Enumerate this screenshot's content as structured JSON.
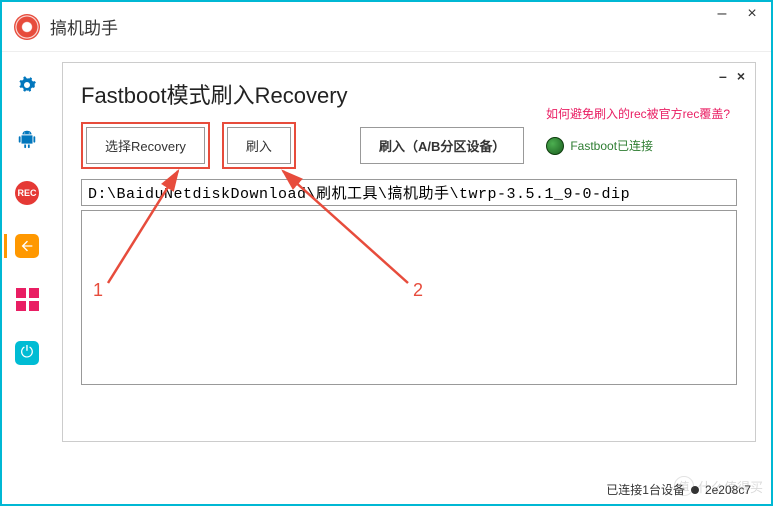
{
  "app": {
    "title": "搞机助手"
  },
  "sidebar": {
    "rec_label": "REC"
  },
  "dialog": {
    "title": "Fastboot模式刷入Recovery",
    "help_link": "如何避免刷入的rec被官方rec覆盖?",
    "select_recovery_label": "选择Recovery",
    "flash_label": "刷入",
    "flash_ab_label": "刷入（A/B分区设备）",
    "status_text": "Fastboot已连接",
    "file_path": "D:\\BaiduNetdiskDownload\\刷机工具\\搞机助手\\twrp-3.5.1_9-0-dip"
  },
  "annotations": {
    "label1": "1",
    "label2": "2"
  },
  "footer": {
    "status": "已连接1台设备",
    "device_id": "2e208c7"
  },
  "watermark": {
    "text": "什么值得买",
    "dot": "值"
  }
}
